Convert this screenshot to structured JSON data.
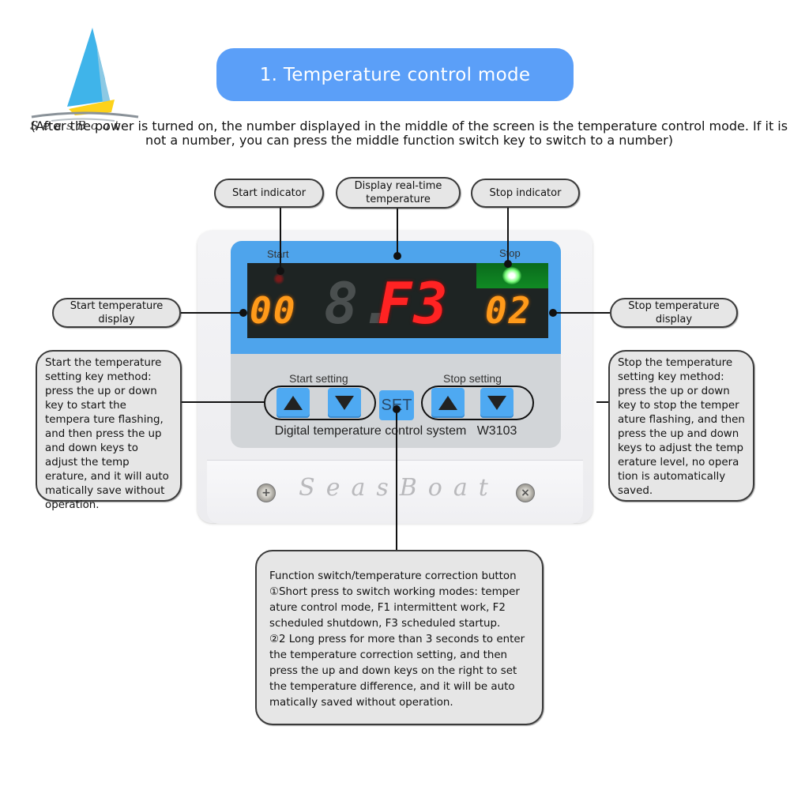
{
  "logo": {
    "icon": "sailboat-icon",
    "text": "SeasBoat"
  },
  "title": "1. Temperature control mode",
  "intro": "(After the power is turned on, the number displayed in the middle of the screen is the temperature control mode. If it is not a number, you can press the middle function switch key to switch to a number)",
  "callouts": {
    "start_indicator": "Start indicator",
    "realtime_temp": "Display real-time temperature",
    "stop_indicator": "Stop indicator",
    "start_temp_display": "Start temperature display",
    "stop_temp_display": "Stop temperature display",
    "start_setting_method": "Start the temperature setting key method: press the up or down key to start the tempera ture flashing, and then press the up and down keys to adjust the temp erature, and it will auto matically save without operation.",
    "stop_setting_method": "Stop the temperature setting key method: press the up or down key to stop the temper ature flashing, and then press the up and down keys to adjust the temp erature level, no opera tion is automatically saved.",
    "function_button": {
      "heading": "Function switch/temperature correction button",
      "line1": "①Short press to switch working modes: temper ature control mode, F1 intermittent work, F2 scheduled shutdown, F3 scheduled startup.",
      "line2": "②2 Long press for more than 3 seconds to enter the temperature correction setting, and then press the up and down keys on the right to set the temperature difference, and it will be auto matically saved without operation."
    }
  },
  "device": {
    "start_label": "Start",
    "stop_label": "Stop",
    "start_display": "00",
    "center_display_dim": "8.",
    "center_display": "F3",
    "stop_display": "02",
    "start_led": "off",
    "stop_led": "on",
    "start_setting_label": "Start setting",
    "stop_setting_label": "Stop setting",
    "set_label": "SET",
    "model_label": "Digital temperature control system",
    "model_number": "W3103",
    "brand": "SeasBoat",
    "colors": {
      "panel_blue": "#4ea4ec",
      "segment_orange": "#ff9a1a",
      "segment_red": "#ff2323",
      "led_green": "#7cff7c",
      "title_blue": "#5b9ff8"
    }
  }
}
